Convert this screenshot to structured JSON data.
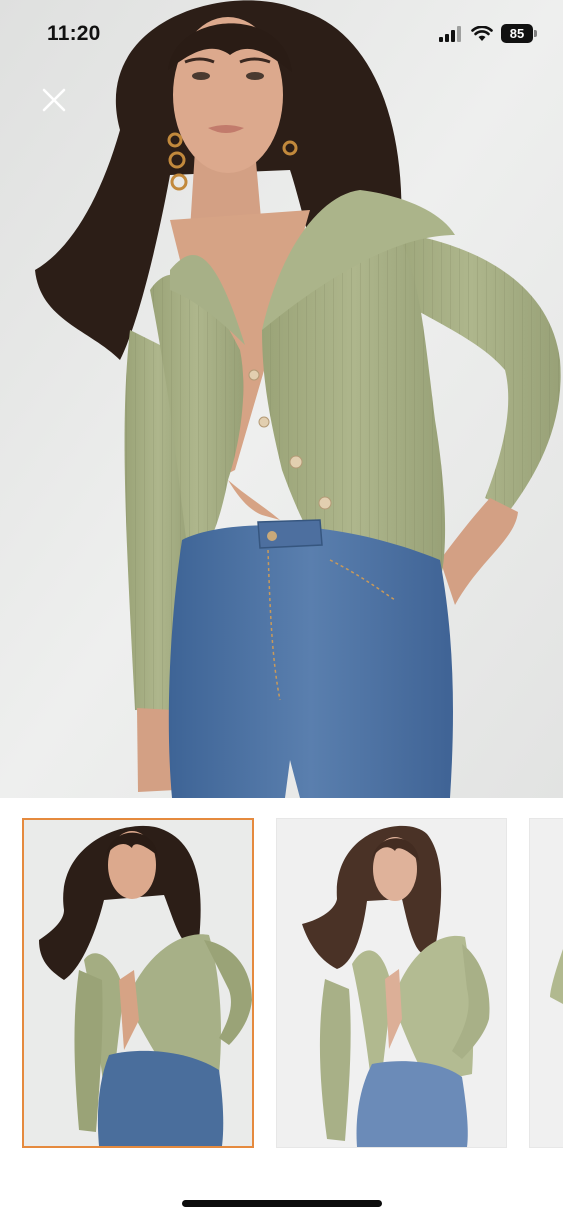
{
  "status_bar": {
    "time": "11:20",
    "battery_level": "85",
    "icons": [
      "signal-icon",
      "wifi-icon",
      "battery-icon"
    ]
  },
  "toolbar": {
    "close_icon": "close-icon"
  },
  "gallery": {
    "selected_index": 0,
    "accent_color": "#e58a3e",
    "thumbnails": [
      {
        "selected": true
      },
      {
        "selected": false
      },
      {
        "selected": false
      }
    ]
  },
  "colors": {
    "sweater": "#a4ad82",
    "denim": "#4a6e9c",
    "background": "#e6e7e6",
    "hair": "#2c1e17",
    "skin": "#d9a488"
  }
}
